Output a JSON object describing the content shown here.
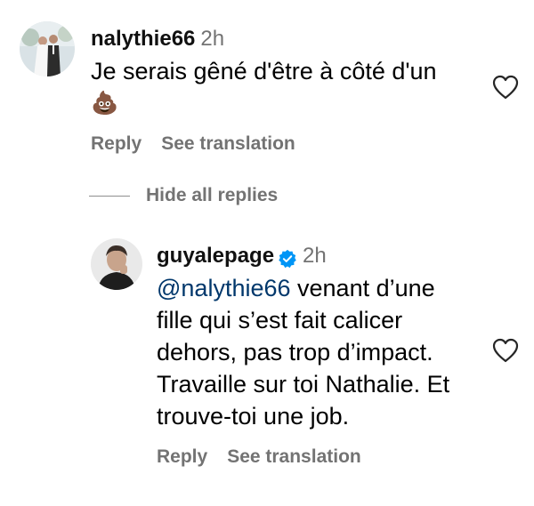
{
  "comments": [
    {
      "username": "nalythie66",
      "time": "2h",
      "text_line1": "Je serais gêné d'être à côté d'un",
      "text_line2": "💩",
      "reply_label": "Reply",
      "translate_label": "See translation"
    },
    {
      "username": "guyalepage",
      "verified": true,
      "time": "2h",
      "mention": "@nalythie66",
      "text_line1_rest": " venant d’une",
      "text_line2": "fille qui s’est fait calicer",
      "text_line3": "dehors, pas trop d’impact.",
      "text_line4": "Travaille sur toi Nathalie. Et",
      "text_line5": "trouve-toi une job.",
      "reply_label": "Reply",
      "translate_label": "See translation"
    }
  ],
  "replies_toggle": {
    "label": "Hide all replies"
  },
  "icons": {
    "like": "heart-outline-icon",
    "verified": "verified-badge-icon"
  },
  "colors": {
    "mention": "#00376b",
    "secondary_text": "#737373",
    "verified": "#0095f6"
  }
}
